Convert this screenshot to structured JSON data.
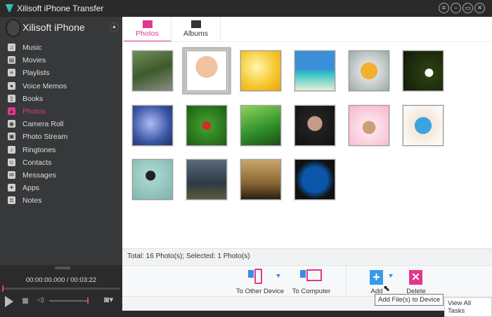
{
  "app": {
    "title": "Xilisoft iPhone Transfer",
    "accent": "#e2378f"
  },
  "window_buttons": [
    "menu-icon",
    "minimize-icon",
    "maximize-icon",
    "close-icon"
  ],
  "device": {
    "name": "Xilisoft iPhone"
  },
  "sidebar": {
    "items": [
      {
        "label": "Music",
        "icon": "music-icon",
        "glyph": "♫"
      },
      {
        "label": "Movies",
        "icon": "film-icon",
        "glyph": "▤"
      },
      {
        "label": "Playlists",
        "icon": "playlist-icon",
        "glyph": "≡"
      },
      {
        "label": "Voice Memos",
        "icon": "microphone-icon",
        "glyph": "●"
      },
      {
        "label": "Books",
        "icon": "book-icon",
        "glyph": "▯"
      },
      {
        "label": "Photos",
        "icon": "photo-icon",
        "glyph": "▲",
        "selected": true
      },
      {
        "label": "Camera Roll",
        "icon": "camera-icon",
        "glyph": "◉"
      },
      {
        "label": "Photo Stream",
        "icon": "photo-stream-icon",
        "glyph": "▣"
      },
      {
        "label": "Ringtones",
        "icon": "bell-icon",
        "glyph": "♪"
      },
      {
        "label": "Contacts",
        "icon": "contacts-icon",
        "glyph": "☺"
      },
      {
        "label": "Messages",
        "icon": "message-icon",
        "glyph": "✉"
      },
      {
        "label": "Apps",
        "icon": "apps-icon",
        "glyph": "✦"
      },
      {
        "label": "Notes",
        "icon": "notes-icon",
        "glyph": "≣"
      }
    ]
  },
  "player": {
    "time": "00:00:00.000 / 00:03:22",
    "progress": 0.0,
    "volume": 0.8
  },
  "tabs": [
    {
      "label": "Photos",
      "selected": true
    },
    {
      "label": "Albums"
    }
  ],
  "photos": [
    {
      "bg": "linear-gradient(160deg,#6f8f5a,#3d5a2c 50%,#8a8d7f)"
    },
    {
      "bg": "radial-gradient(circle at 50% 40%,#f0c2a0 0 35%,#fff 36%)",
      "selected": true
    },
    {
      "bg": "radial-gradient(circle at 40% 40%,#fff7b0,#f5c528 60%,#e9a413)"
    },
    {
      "bg": "linear-gradient(180deg,#3a8fd8 0 45%,#2dbfc5 55%,#e6f0d8)"
    },
    {
      "bg": "radial-gradient(circle at 50% 50%,#f1b12e 0 30%,#ddd 31%,#9aa 100%)"
    },
    {
      "bg": "radial-gradient(circle at 65% 55%,#fff 0 12%,#2c3f12 13%,#0f1a07)"
    },
    {
      "bg": "radial-gradient(circle at 45% 45%,#aebcf2,#3d57a8 60%,#203060)"
    },
    {
      "bg": "radial-gradient(circle at 50% 50%,#d32a2a 0 15%,#3f9a2b 16%,#1d5d14)"
    },
    {
      "bg": "linear-gradient(160deg,#8bd45a,#2f8d2a 60%,#1c4f14)"
    },
    {
      "bg": "radial-gradient(circle at 50% 45%,#c49b86 0 25%,#222 26%,#111)"
    },
    {
      "bg": "radial-gradient(circle at 50% 55%,#caa07a 0 22%,#fde3ea 23%,#f8b6cf)"
    },
    {
      "bg": "radial-gradient(circle at 50% 50%,#3aa4e0 0 30%,#f3e7d8 31%,#fff)"
    },
    {
      "bg": "radial-gradient(circle at 45% 40%,#222 0 15%,#a8d6cf 16%,#7fb3aa)"
    },
    {
      "bg": "linear-gradient(180deg,#596977,#2e3a46 60%,#5e5a3f)"
    },
    {
      "bg": "linear-gradient(180deg,#c8a66a,#8a6532 60%,#2a1f14)"
    },
    {
      "bg": "radial-gradient(circle,#0b56a8 0 45%,#111 70%)"
    }
  ],
  "status": "Total: 16 Photo(s); Selected: 1 Photo(s)",
  "toolbar": {
    "to_other_device": "To Other Device",
    "to_computer": "To Computer",
    "add": "Add",
    "delete": "Delete"
  },
  "tooltip": "Add File(s) to Device",
  "view_all_tasks": "View All Tasks"
}
